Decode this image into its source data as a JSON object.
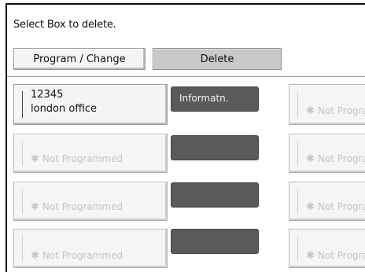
{
  "instruction": "Select Box to delete.",
  "buttons": {
    "program_change": "Program / Change",
    "delete": "Delete"
  },
  "boxes": [
    {
      "line1": "12345",
      "line2": "london office",
      "info": "Informatn."
    },
    {
      "not_programmed": "Not Programmed",
      "right": "Not Progra"
    },
    {
      "not_programmed": "Not Programmed",
      "right": "Not Progra"
    },
    {
      "not_programmed": "Not Programmed",
      "right": "Not Progra"
    }
  ],
  "icons": {
    "not_programmed": "asterisk-icon"
  },
  "colors": {
    "info_button": "#5a5a5a",
    "delete_selected": "#c9c9c9",
    "not_programmed_text": "#c4c4c4"
  }
}
